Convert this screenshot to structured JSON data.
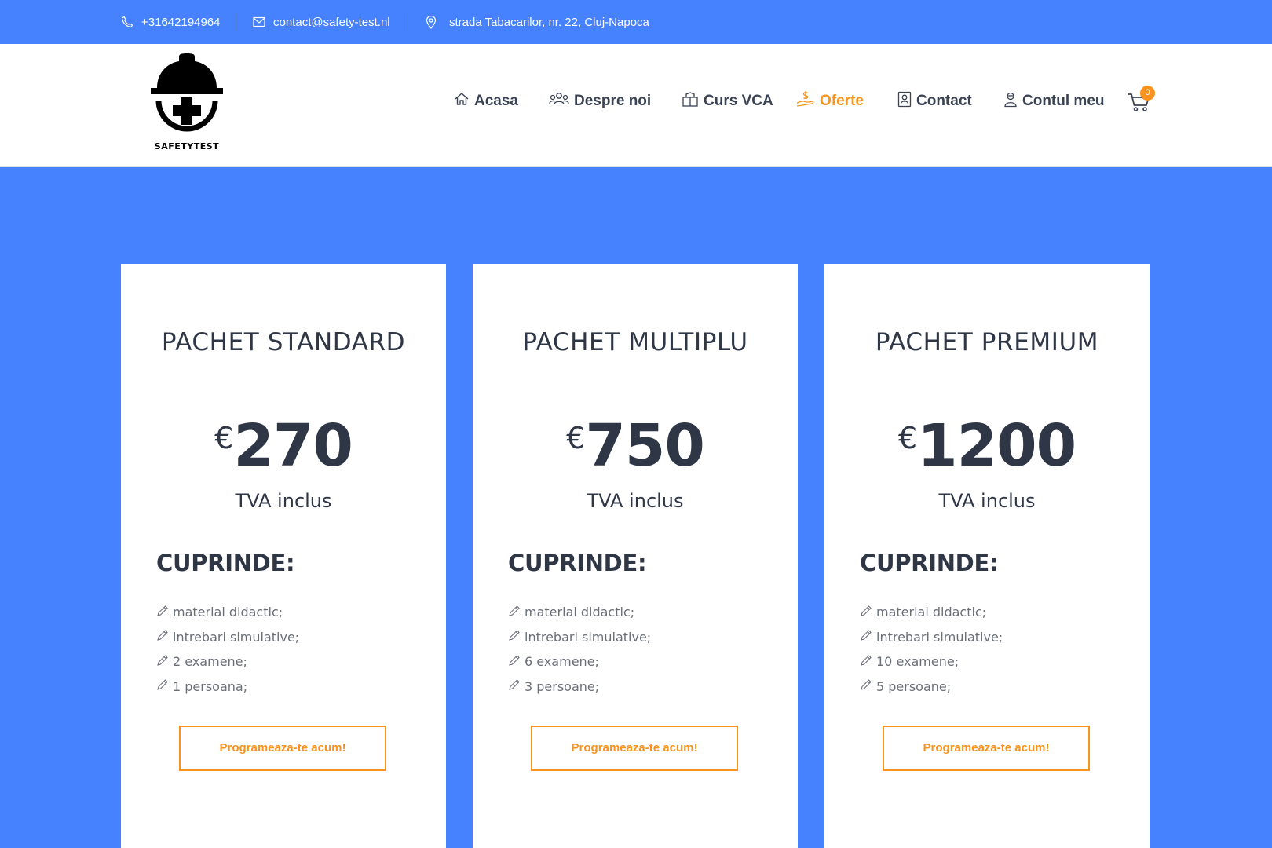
{
  "topbar": {
    "phone": "+31642194964",
    "email": "contact@safety-test.nl",
    "address": "strada Tabacarilor, nr. 22, Cluj-Napoca"
  },
  "logo": {
    "text": "SAFETYTEST"
  },
  "nav": {
    "home": "Acasa",
    "about": "Despre noi",
    "course": "Curs VCA",
    "offers": "Oferte",
    "contact": "Contact",
    "account": "Contul meu",
    "cart_count": "0"
  },
  "colors": {
    "brand_blue": "#4682fe",
    "accent_orange": "#f7931e",
    "text_dark": "#2f3747"
  },
  "packages": [
    {
      "title": "PACHET STANDARD",
      "currency": "€",
      "price": "270",
      "vat": "TVA inclus",
      "includes_heading": "CUPRINDE:",
      "features": [
        "material didactic;",
        "intrebari simulative;",
        "2 examene;",
        "1 persoana;"
      ],
      "button": "Programeaza-te acum!"
    },
    {
      "title": "PACHET MULTIPLU",
      "currency": "€",
      "price": "750",
      "vat": "TVA inclus",
      "includes_heading": "CUPRINDE:",
      "features": [
        "material didactic;",
        "intrebari simulative;",
        "6 examene;",
        "3 persoane;"
      ],
      "button": "Programeaza-te acum!"
    },
    {
      "title": "PACHET PREMIUM",
      "currency": "€",
      "price": "1200",
      "vat": "TVA inclus",
      "includes_heading": "CUPRINDE:",
      "features": [
        "material didactic;",
        "intrebari simulative;",
        "10 examene;",
        "5 persoane;"
      ],
      "button": "Programeaza-te acum!"
    }
  ]
}
